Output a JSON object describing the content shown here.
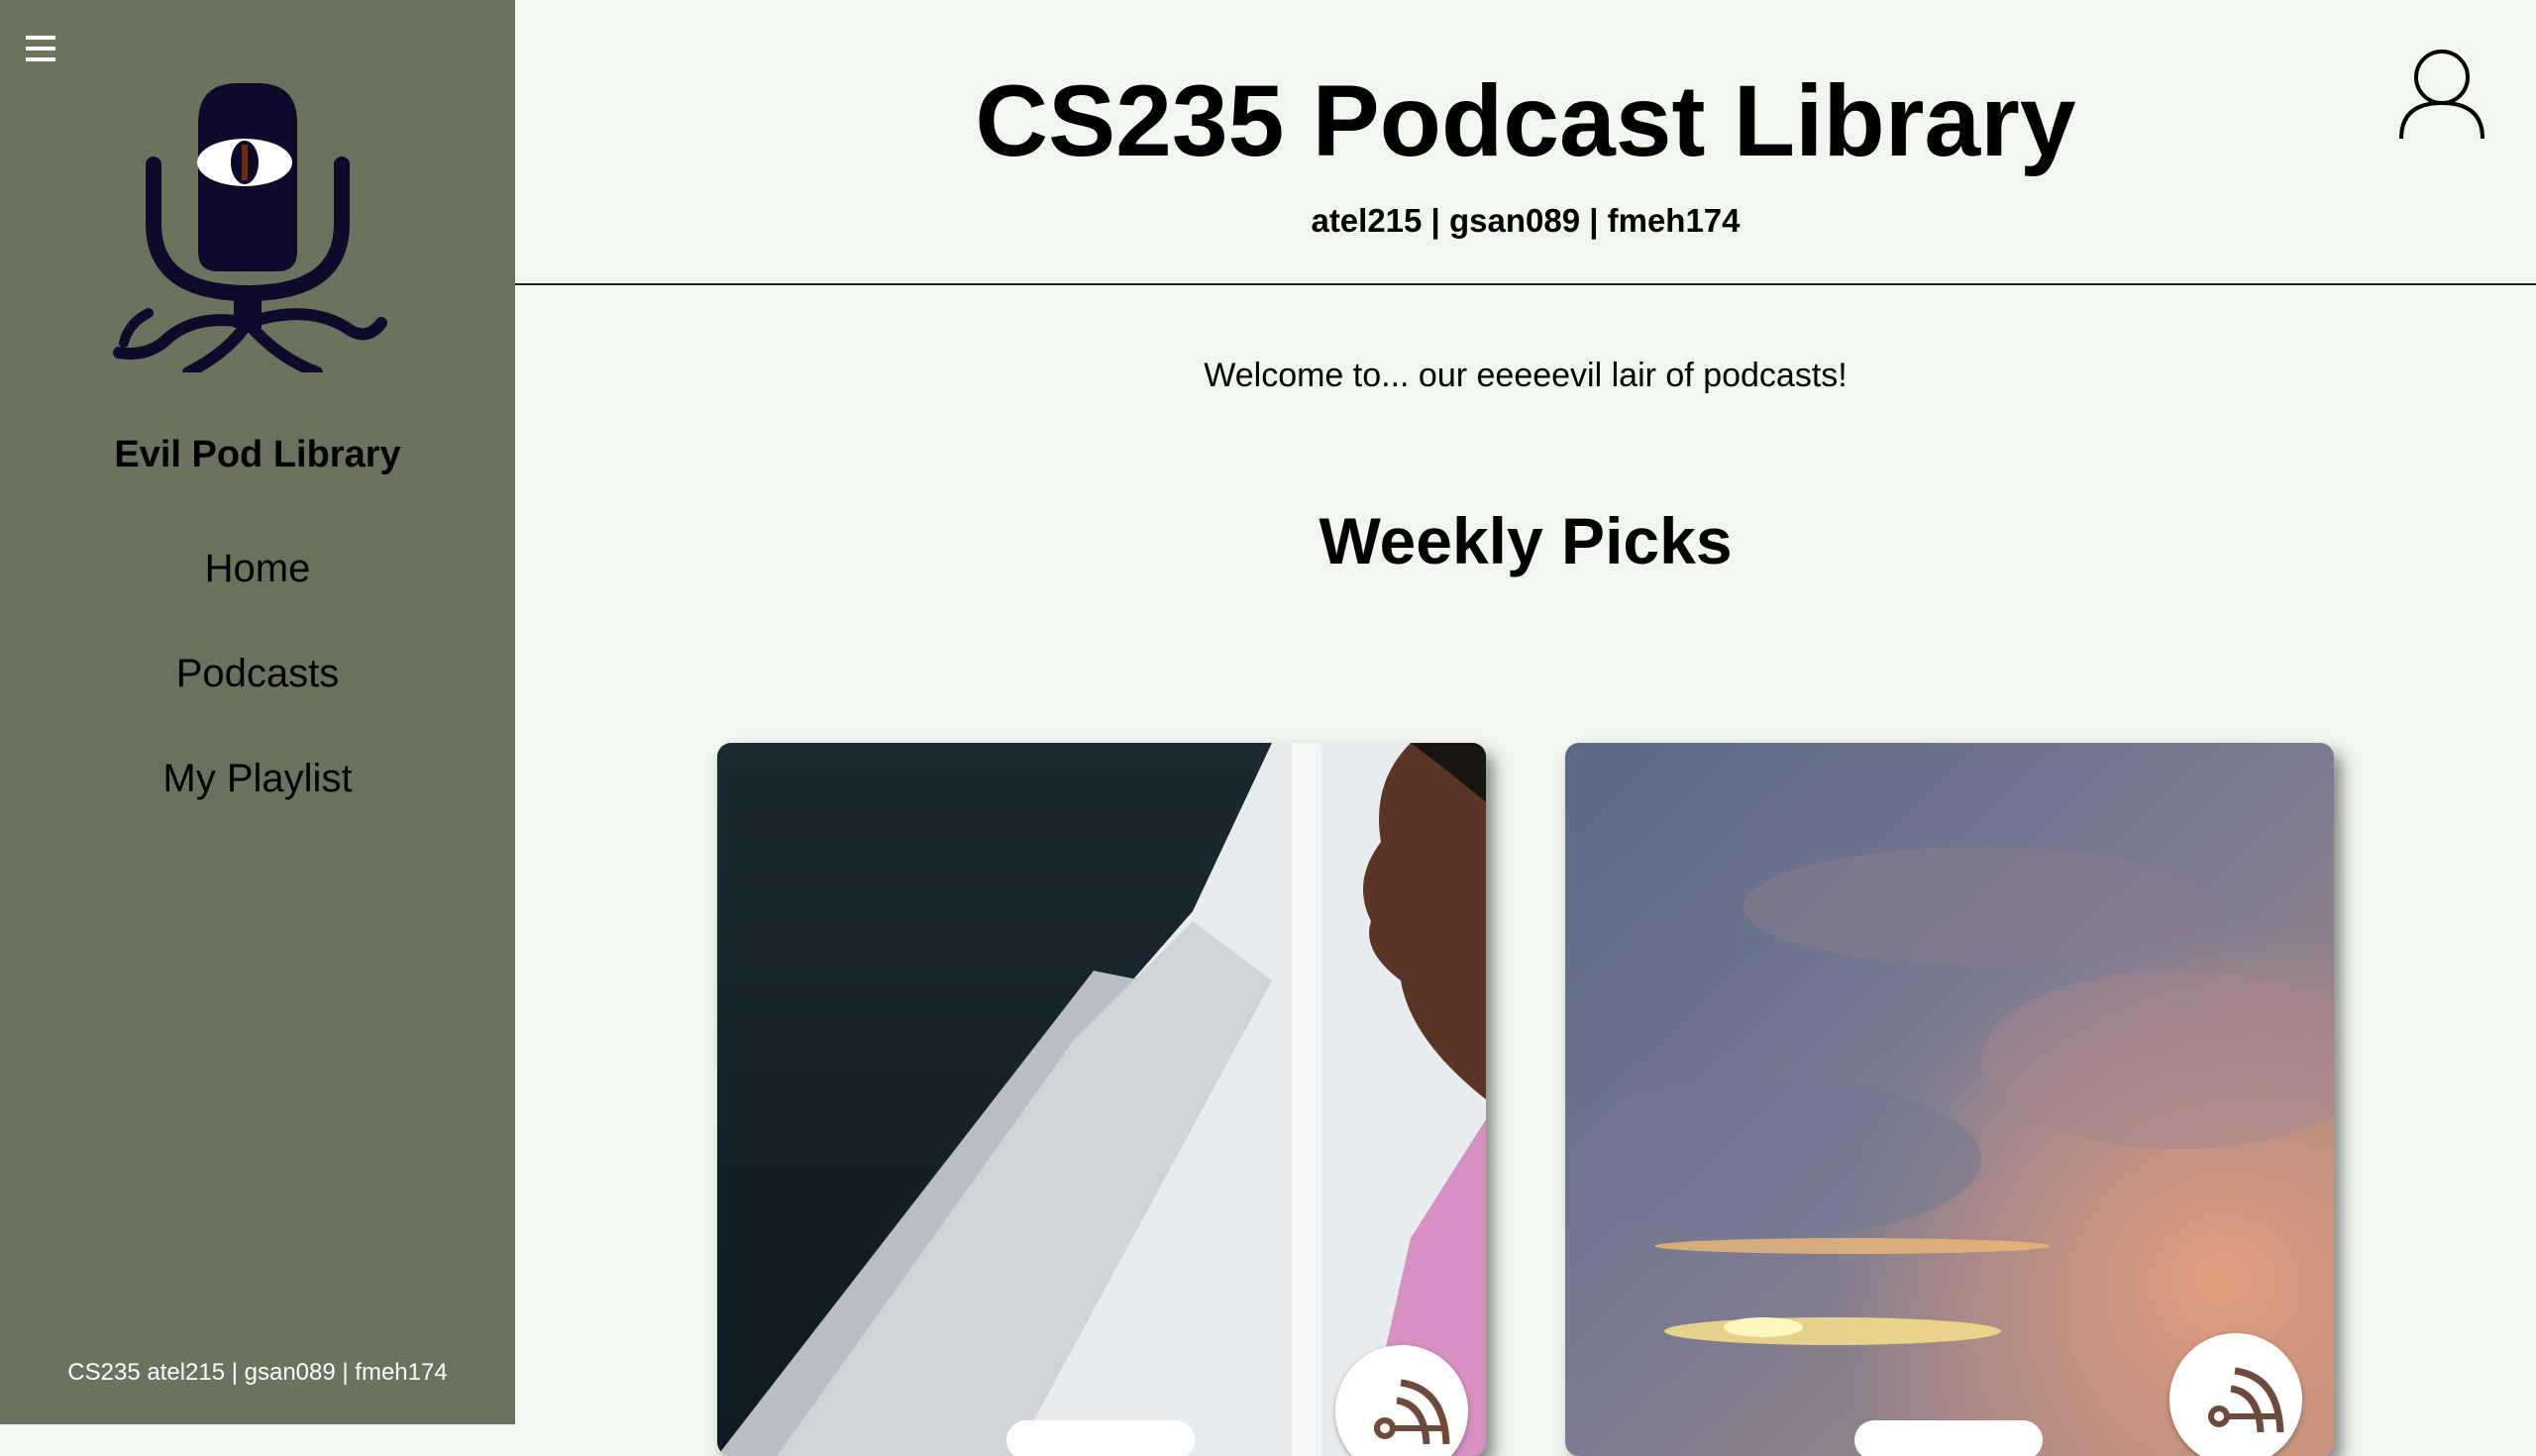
{
  "sidebar": {
    "brand": "Evil Pod Library",
    "nav": [
      {
        "label": "Home"
      },
      {
        "label": "Podcasts"
      },
      {
        "label": "My Playlist"
      }
    ],
    "footer": "CS235 atel215 | gsan089 | fmeh174",
    "background_color": "#6b735e"
  },
  "header": {
    "title": "CS235 Podcast Library",
    "authors": "atel215 | gsan089 | fmeh174"
  },
  "main": {
    "welcome": "Welcome to... our eeeeevil lair of podcasts!",
    "section_title": "Weekly Picks",
    "cards": [
      {
        "image": "person-on-boat-photo",
        "icon": "podcast-icon"
      },
      {
        "image": "sunset-clouds-photo",
        "icon": "podcast-icon"
      }
    ]
  },
  "icons": {
    "menu": "hamburger-icon",
    "user": "user-account-icon",
    "logo": "evil-eye-microphone-logo"
  }
}
